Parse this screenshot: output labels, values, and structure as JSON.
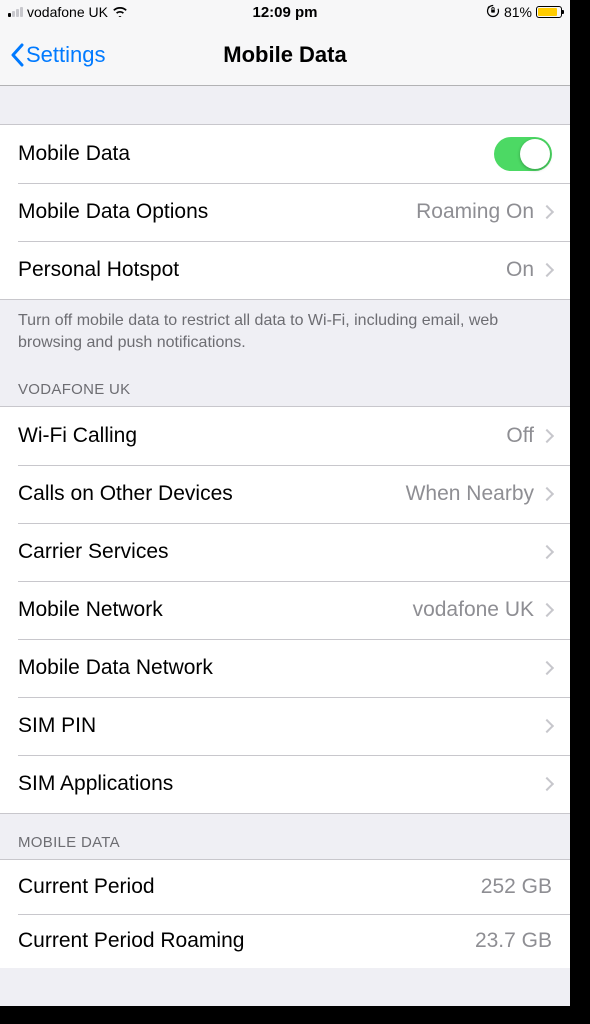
{
  "status_bar": {
    "carrier": "vodafone UK",
    "time": "12:09 pm",
    "battery_percent": "81%",
    "battery_fill_pct": 81
  },
  "nav": {
    "back_label": "Settings",
    "title": "Mobile Data"
  },
  "group1": {
    "mobile_data": {
      "label": "Mobile Data",
      "on": true
    },
    "options": {
      "label": "Mobile Data Options",
      "value": "Roaming On"
    },
    "hotspot": {
      "label": "Personal Hotspot",
      "value": "On"
    }
  },
  "group1_footer": "Turn off mobile data to restrict all data to Wi-Fi, including email, web browsing and push notifications.",
  "carrier_section_header": "VODAFONE UK",
  "group2": {
    "wifi_calling": {
      "label": "Wi-Fi Calling",
      "value": "Off"
    },
    "calls_other": {
      "label": "Calls on Other Devices",
      "value": "When Nearby"
    },
    "carrier_services": {
      "label": "Carrier Services",
      "value": ""
    },
    "mobile_network": {
      "label": "Mobile Network",
      "value": "vodafone UK"
    },
    "mobile_data_network": {
      "label": "Mobile Data Network",
      "value": ""
    },
    "sim_pin": {
      "label": "SIM PIN",
      "value": ""
    },
    "sim_apps": {
      "label": "SIM Applications",
      "value": ""
    }
  },
  "usage_section_header": "MOBILE DATA",
  "group3": {
    "current_period": {
      "label": "Current Period",
      "value": "252 GB"
    },
    "current_period_roaming": {
      "label": "Current Period Roaming",
      "value": "23.7 GB"
    }
  }
}
